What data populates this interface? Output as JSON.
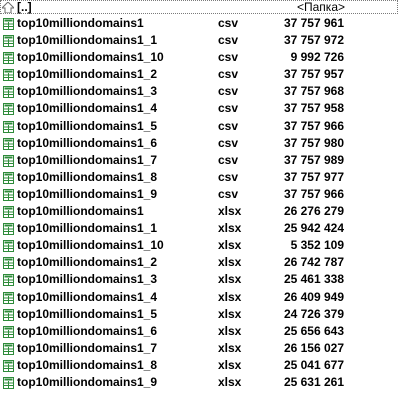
{
  "list": {
    "up_row": {
      "label": "[..]",
      "size_text": "<Папка>"
    },
    "files": [
      {
        "name": "top10milliondomains1",
        "ext": "csv",
        "size": "37 757 961"
      },
      {
        "name": "top10milliondomains1_1",
        "ext": "csv",
        "size": "37 757 972"
      },
      {
        "name": "top10milliondomains1_10",
        "ext": "csv",
        "size": "9 992 726"
      },
      {
        "name": "top10milliondomains1_2",
        "ext": "csv",
        "size": "37 757 957"
      },
      {
        "name": "top10milliondomains1_3",
        "ext": "csv",
        "size": "37 757 968"
      },
      {
        "name": "top10milliondomains1_4",
        "ext": "csv",
        "size": "37 757 958"
      },
      {
        "name": "top10milliondomains1_5",
        "ext": "csv",
        "size": "37 757 966"
      },
      {
        "name": "top10milliondomains1_6",
        "ext": "csv",
        "size": "37 757 980"
      },
      {
        "name": "top10milliondomains1_7",
        "ext": "csv",
        "size": "37 757 989"
      },
      {
        "name": "top10milliondomains1_8",
        "ext": "csv",
        "size": "37 757 977"
      },
      {
        "name": "top10milliondomains1_9",
        "ext": "csv",
        "size": "37 757 966"
      },
      {
        "name": "top10milliondomains1",
        "ext": "xlsx",
        "size": "26 276 279"
      },
      {
        "name": "top10milliondomains1_1",
        "ext": "xlsx",
        "size": "25 942 424"
      },
      {
        "name": "top10milliondomains1_10",
        "ext": "xlsx",
        "size": "5 352 109"
      },
      {
        "name": "top10milliondomains1_2",
        "ext": "xlsx",
        "size": "26 742 787"
      },
      {
        "name": "top10milliondomains1_3",
        "ext": "xlsx",
        "size": "25 461 338"
      },
      {
        "name": "top10milliondomains1_4",
        "ext": "xlsx",
        "size": "26 409 949"
      },
      {
        "name": "top10milliondomains1_5",
        "ext": "xlsx",
        "size": "24 726 379"
      },
      {
        "name": "top10milliondomains1_6",
        "ext": "xlsx",
        "size": "25 656 643"
      },
      {
        "name": "top10milliondomains1_7",
        "ext": "xlsx",
        "size": "26 156 027"
      },
      {
        "name": "top10milliondomains1_8",
        "ext": "xlsx",
        "size": "25 041 677"
      },
      {
        "name": "top10milliondomains1_9",
        "ext": "xlsx",
        "size": "25 631 261"
      }
    ]
  },
  "icons": {
    "up": "up-folder-icon",
    "file": "spreadsheet-file-icon"
  },
  "colors": {
    "file_icon_green": "#2e8b3a",
    "up_icon_gray": "#6b6b6b"
  }
}
